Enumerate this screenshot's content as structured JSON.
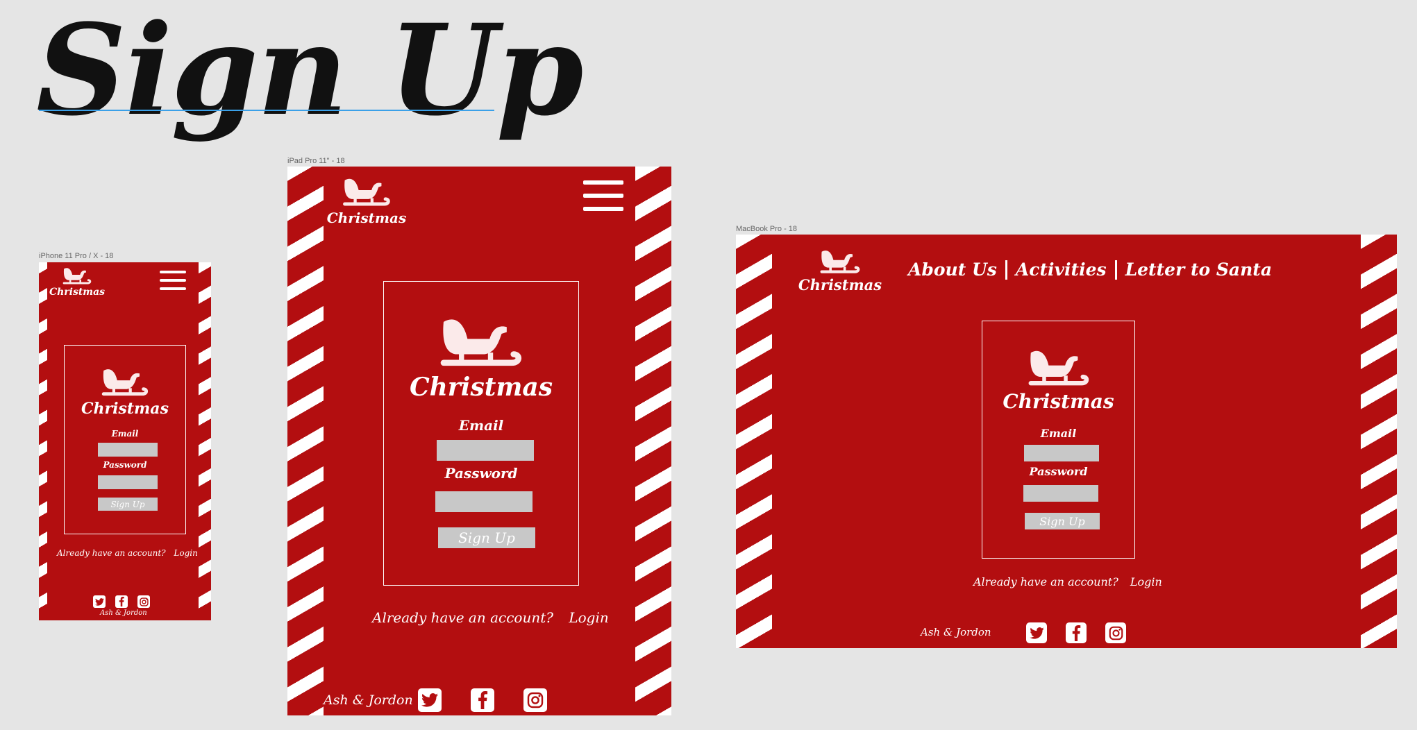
{
  "page": {
    "title": "Sign Up"
  },
  "artboards": {
    "iphone": "iPhone 11 Pro / X - 18",
    "ipad": "iPad Pro 11\" - 18",
    "macbook": "MacBook Pro - 18"
  },
  "brand": {
    "name": "Christmas",
    "logo_icon": "sleigh-icon"
  },
  "nav": {
    "items": [
      "About Us",
      "Activities",
      "Letter to Santa"
    ],
    "menu_icon": "hamburger-menu-icon"
  },
  "form": {
    "email_label": "Email",
    "email_value": "",
    "password_label": "Password",
    "password_value": "",
    "submit_label": "Sign Up"
  },
  "account": {
    "prompt": "Already have an account?",
    "login_label": "Login"
  },
  "footer": {
    "credits": "Ash & Jordon",
    "social_icons": [
      "twitter-icon",
      "facebook-icon",
      "instagram-icon"
    ]
  },
  "colors": {
    "brand_red": "#b30e10",
    "field_gray": "#c8c8c8",
    "white": "#ffffff",
    "canvas": "#e5e5e5",
    "guide_blue": "#3aa0e8"
  }
}
